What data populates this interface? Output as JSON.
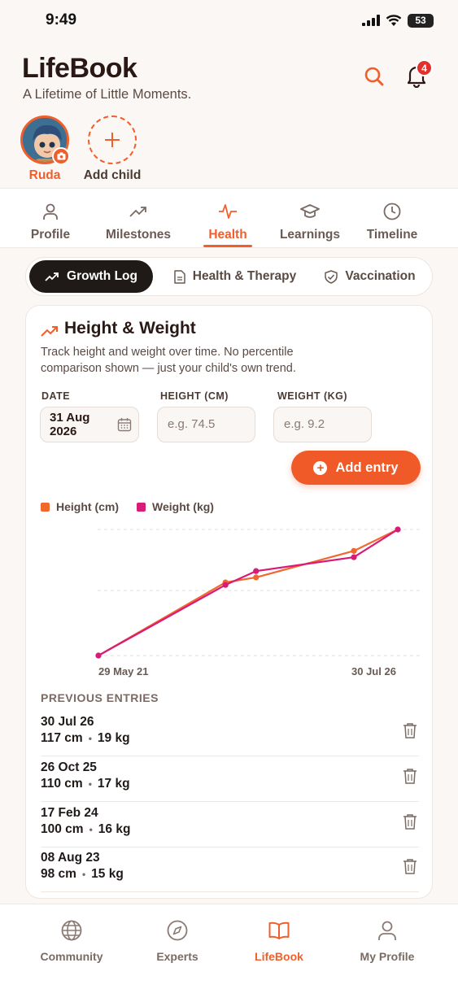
{
  "status_bar": {
    "time": "9:49",
    "battery": "53"
  },
  "header": {
    "title": "LifeBook",
    "tagline": "A Lifetime of Little Moments.",
    "notification_count": "4"
  },
  "children": {
    "selected_name": "Ruda",
    "add_label": "Add child"
  },
  "tabs": [
    {
      "label": "Profile",
      "icon": "person-icon"
    },
    {
      "label": "Milestones",
      "icon": "trend-up-icon"
    },
    {
      "label": "Health",
      "icon": "pulse-icon",
      "active": true
    },
    {
      "label": "Learnings",
      "icon": "graduation-cap-icon"
    },
    {
      "label": "Timeline",
      "icon": "clock-icon"
    }
  ],
  "subtabs": [
    {
      "label": "Growth Log",
      "icon": "trend-up-icon",
      "active": true
    },
    {
      "label": "Health & Therapy",
      "icon": "document-icon"
    },
    {
      "label": "Vaccination",
      "icon": "shield-check-icon"
    }
  ],
  "card": {
    "title": "Height & Weight",
    "description": "Track height and weight over time. No percentile comparison shown — just your child's own trend.",
    "fields": {
      "date_label": "DATE",
      "date_line1": "31 Aug",
      "date_line2": "2026",
      "height_label": "HEIGHT (CM)",
      "height_placeholder": "e.g. 74.5",
      "weight_label": "WEIGHT (KG)",
      "weight_placeholder": "e.g. 9.2"
    },
    "add_button": "Add entry",
    "legend": {
      "height": "Height (cm)",
      "weight": "Weight (kg)"
    },
    "x_start": "29 May 21",
    "x_end": "30 Jul 26",
    "previous_heading": "PREVIOUS ENTRIES",
    "entries": [
      {
        "date": "30 Jul 26",
        "height": "117 cm",
        "weight": "19 kg"
      },
      {
        "date": "26 Oct 25",
        "height": "110 cm",
        "weight": "17 kg"
      },
      {
        "date": "17 Feb 24",
        "height": "100 cm",
        "weight": "16 kg"
      },
      {
        "date": "08 Aug 23",
        "height": "98 cm",
        "weight": "15 kg"
      }
    ]
  },
  "bottom_nav": [
    {
      "label": "Community",
      "icon": "globe-icon"
    },
    {
      "label": "Experts",
      "icon": "compass-icon"
    },
    {
      "label": "LifeBook",
      "icon": "open-book-icon",
      "active": true
    },
    {
      "label": "My Profile",
      "icon": "person-icon"
    }
  ],
  "colors": {
    "accent": "#ef5f2c",
    "height_series": "#f0682e",
    "weight_series": "#d81a78"
  },
  "chart_data": {
    "type": "line",
    "x_axis": "date",
    "x_tick_labels": [
      "29 May 21",
      "30 Jul 26"
    ],
    "grid": "horizontal dashed",
    "legend_position": "top-left",
    "normalization": "each series scaled to its own range",
    "series": [
      {
        "name": "Height (cm)",
        "color": "#f0682e",
        "points": [
          {
            "x": "29 May 21",
            "y": null
          },
          {
            "x": "08 Aug 23",
            "y": 98
          },
          {
            "x": "17 Feb 24",
            "y": 100
          },
          {
            "x": "26 Oct 25",
            "y": 110
          },
          {
            "x": "30 Jul 26",
            "y": 117
          }
        ],
        "relative_levels": [
          0.0,
          0.58,
          0.62,
          0.83,
          1.0
        ]
      },
      {
        "name": "Weight (kg)",
        "color": "#d81a78",
        "points": [
          {
            "x": "29 May 21",
            "y": null
          },
          {
            "x": "08 Aug 23",
            "y": 15
          },
          {
            "x": "17 Feb 24",
            "y": 16
          },
          {
            "x": "26 Oct 25",
            "y": 17
          },
          {
            "x": "30 Jul 26",
            "y": 19
          }
        ],
        "relative_levels": [
          0.0,
          0.56,
          0.67,
          0.78,
          1.0
        ]
      }
    ]
  }
}
